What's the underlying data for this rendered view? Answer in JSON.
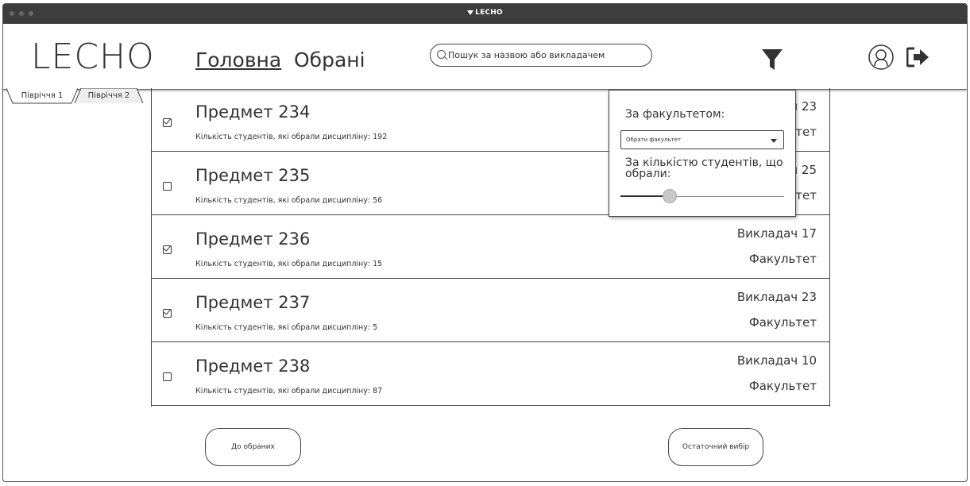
{
  "window": {
    "title": "LECHO"
  },
  "header": {
    "logo": "LECHO",
    "nav_home": "Головна",
    "nav_favorites": "Обрані",
    "search_placeholder": "Пошук за назвою або викладачем"
  },
  "tabs": [
    {
      "label": "Півріччя 1"
    },
    {
      "label": "Півріччя 2"
    }
  ],
  "subjects": [
    {
      "name": "Предмет 234",
      "count_text": "Кількість студентів,  які обрали дисципліну: 192",
      "teacher": "Викладач 23",
      "faculty": "Факультет",
      "checked": true
    },
    {
      "name": "Предмет 235",
      "count_text": "Кількість студентів,  які обрали дисципліну: 56",
      "teacher": "Викладач 25",
      "faculty": "Факультет",
      "checked": false
    },
    {
      "name": "Предмет 236",
      "count_text": "Кількість студентів,  які обрали дисципліну: 15",
      "teacher": "Викладач 17",
      "faculty": "Факультет",
      "checked": true
    },
    {
      "name": "Предмет 237",
      "count_text": "Кількість студентів,  які обрали дисципліну: 5",
      "teacher": "Викладач 23",
      "faculty": "Факультет",
      "checked": true
    },
    {
      "name": "Предмет 238",
      "count_text": "Кількість студентів,  які обрали дисципліну: 87",
      "teacher": "Викладач 10",
      "faculty": "Факультет",
      "checked": false
    }
  ],
  "buttons": {
    "to_favorites": "До обраних",
    "final_choice": "Остаточний вибір"
  },
  "filter_popup": {
    "faculty_label": "За факультетом:",
    "faculty_select_value": "Обрати факультет",
    "count_label": "За кількістю студентів, що обрали:",
    "slider_fraction": 0.3
  },
  "icons": {
    "filter": "filter-icon",
    "user": "user-icon",
    "logout": "logout-icon",
    "search": "search-icon"
  }
}
